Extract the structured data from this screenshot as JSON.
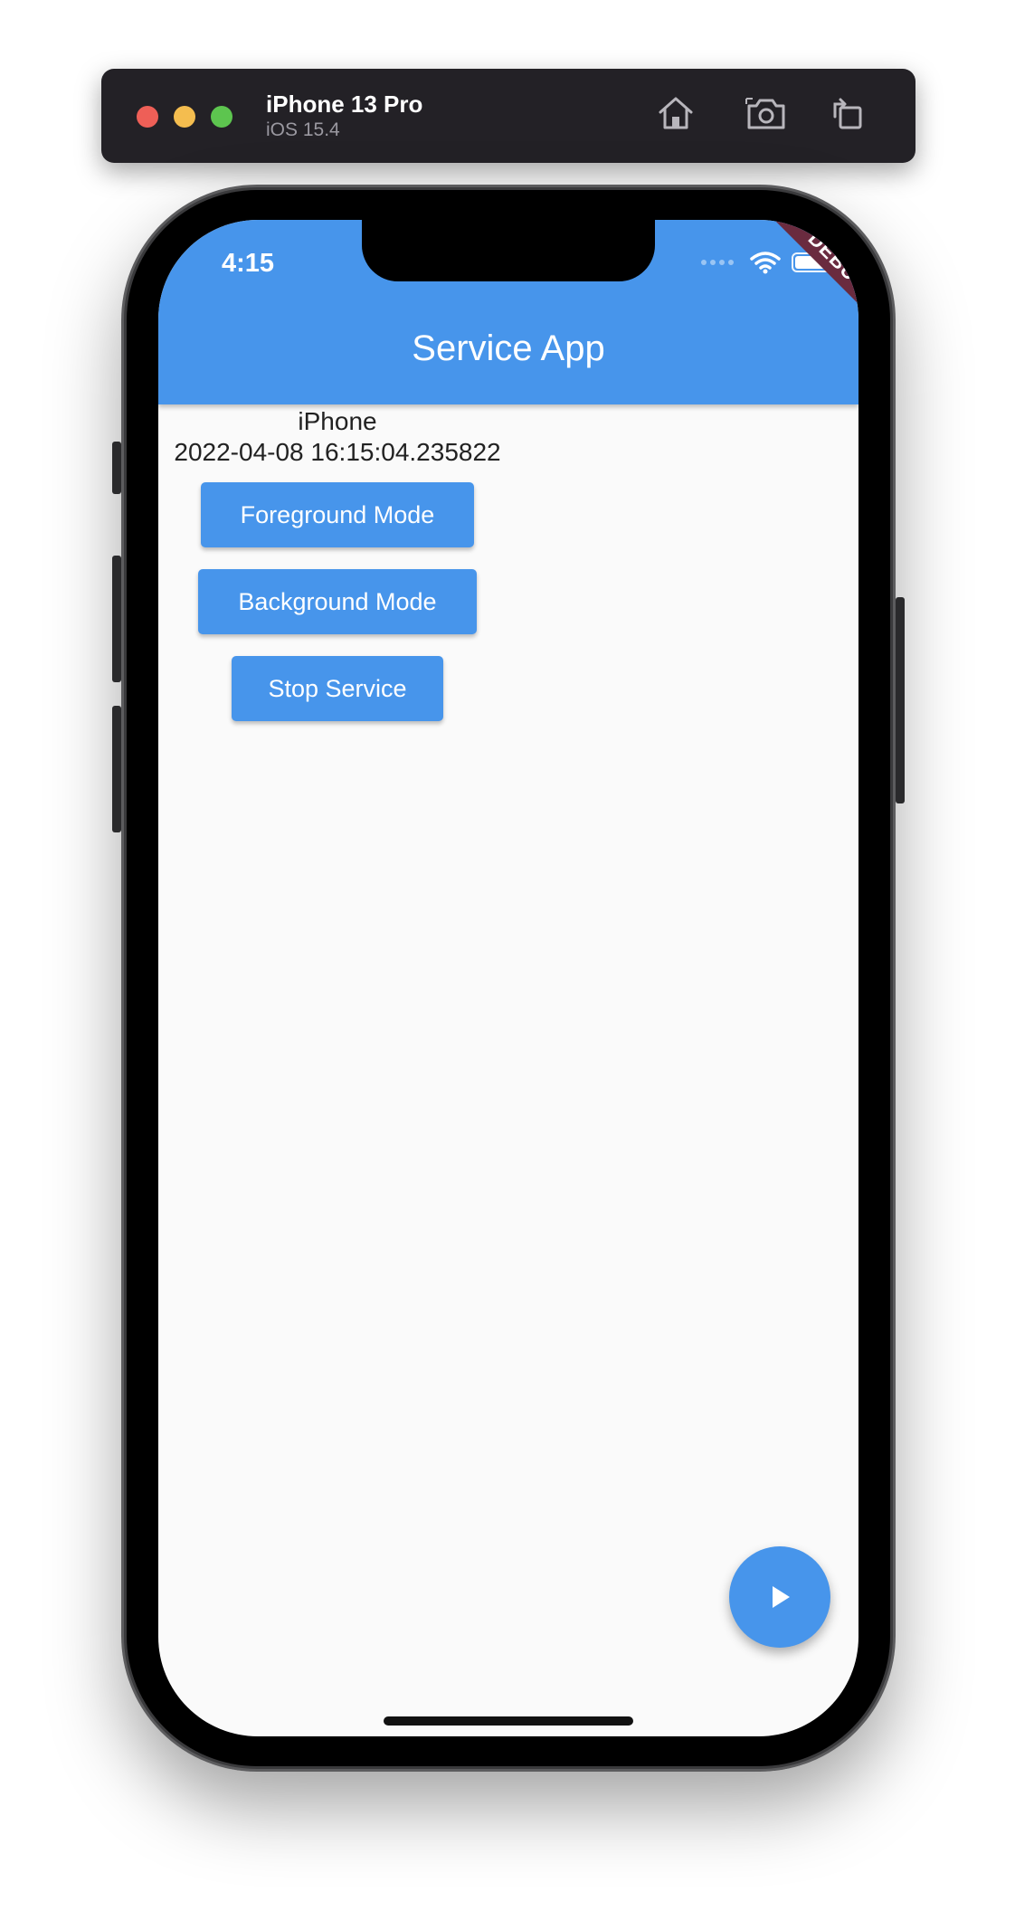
{
  "simulator": {
    "device_name": "iPhone 13 Pro",
    "os_version": "iOS 15.4",
    "toolbar_icons": [
      "home-icon",
      "screenshot-icon",
      "rotate-icon"
    ]
  },
  "status_bar": {
    "time": "4:15",
    "icons": [
      "wifi-icon",
      "battery-icon"
    ]
  },
  "debug_banner": "DEBUG",
  "app_bar": {
    "title": "Service App"
  },
  "content": {
    "device_label": "iPhone",
    "timestamp": "2022-04-08 16:15:04.235822",
    "buttons": {
      "foreground": "Foreground Mode",
      "background": "Background Mode",
      "stop": "Stop Service"
    }
  },
  "fab": {
    "icon": "play-icon"
  },
  "colors": {
    "primary": "#4795eb",
    "background": "#fafafa",
    "banner": "#6a2b3f"
  }
}
